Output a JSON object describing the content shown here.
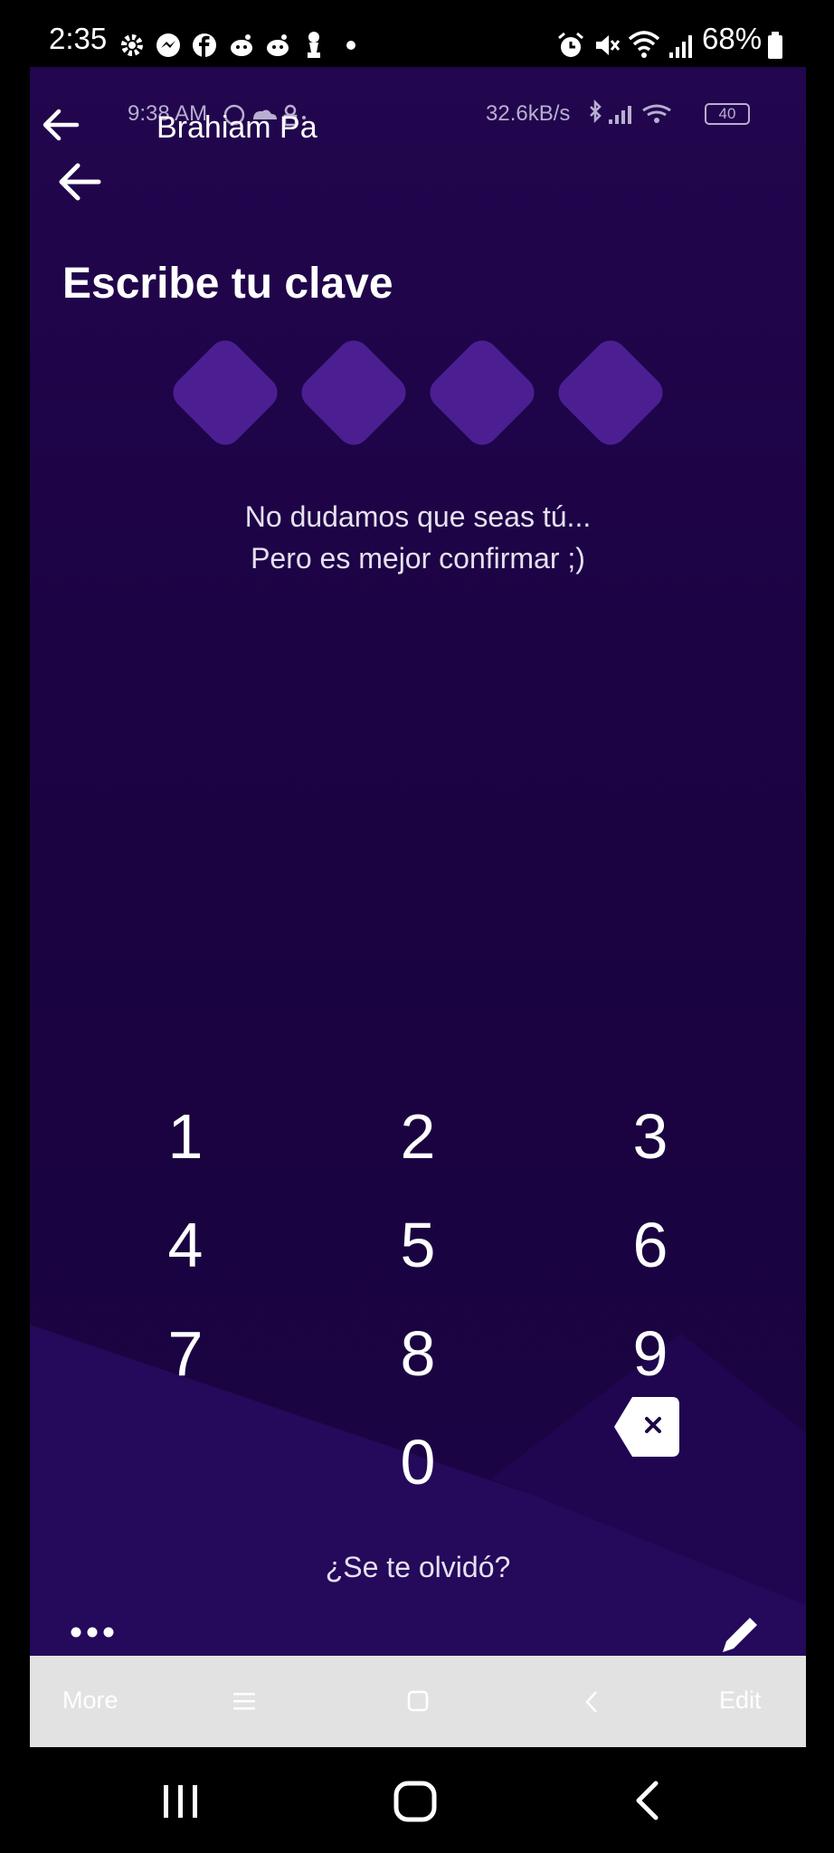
{
  "status_bar": {
    "time": "2:35",
    "battery": "68%"
  },
  "inner_status": {
    "time": "9:38 AM",
    "speed": "32.6kB/s",
    "battery": "40"
  },
  "header": {
    "contact_name": "Brahiam Pa"
  },
  "page": {
    "title": "Escribe tu clave",
    "subtitle_line1": "No dudamos que seas tú...",
    "subtitle_line2": "Pero es mejor confirmar ;)",
    "pin_length": 4,
    "forgot": "¿Se te olvidó?"
  },
  "keypad": {
    "keys": [
      "1",
      "2",
      "3",
      "4",
      "5",
      "6",
      "7",
      "8",
      "9",
      "0"
    ]
  },
  "viewer_toolbar": {
    "more_label": "More",
    "edit_label": "Edit"
  },
  "colors": {
    "background": "#1c0344",
    "pin_box": "#4b1f92",
    "text": "#ffffff"
  }
}
